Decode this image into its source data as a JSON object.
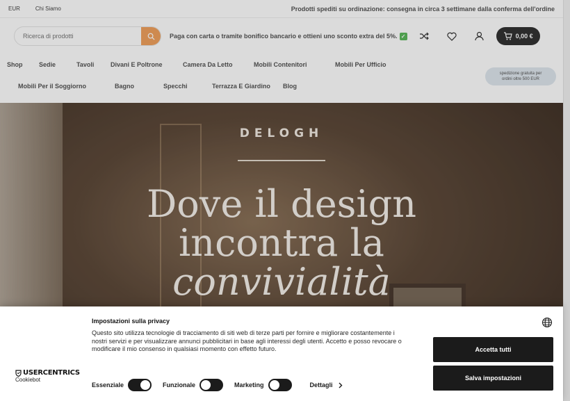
{
  "topbar": {
    "currency": "EUR",
    "about": "Chi Siamo",
    "shipping_note": "Prodotti spediti su ordinazione: consegna in circa 3 settimane dalla conferma dell'ordine"
  },
  "header": {
    "search_placeholder": "Ricerca di prodotti",
    "promo": "Paga con carta o tramite bonifico bancario e ottieni uno sconto extra del 5%.",
    "cart_total": "0,00 €"
  },
  "nav": {
    "row1": [
      "Shop",
      "Sedie",
      "Tavoli",
      "Divani E Poltrone",
      "Camera Da Letto",
      "Mobili Contenitori",
      "Mobili Per Ufficio"
    ],
    "row2": [
      "Mobili Per il Soggiorno",
      "Bagno",
      "Specchi",
      "Terrazza E Giardino",
      "Blog"
    ],
    "free_shipping": [
      "spedizione gratuita per",
      "ordini oltre 500 EUR"
    ]
  },
  "hero": {
    "brand": "DELOGH",
    "line1": "Dove il design",
    "line2": "incontra la",
    "line3": "convivialità"
  },
  "cookie": {
    "title": "Impostazioni sulla privacy",
    "text": "Questo sito utilizza tecnologie di tracciamento di siti web di terze parti per fornire e migliorare costantemente i nostri servizi e per visualizzare annunci pubblicitari in base agli interessi degli utenti. Accetto e posso revocare o modificare il mio consenso in qualsiasi momento con effetto futuro.",
    "logo_top": "USERCENTRICS",
    "logo_bottom": "Cookiebot",
    "accept_all": "Accetta tutti",
    "save_settings": "Salva impostazioni",
    "toggles": [
      {
        "label": "Essenziale",
        "on": true
      },
      {
        "label": "Funzionale",
        "on": false
      },
      {
        "label": "Marketing",
        "on": false
      }
    ],
    "details": "Dettagli"
  }
}
